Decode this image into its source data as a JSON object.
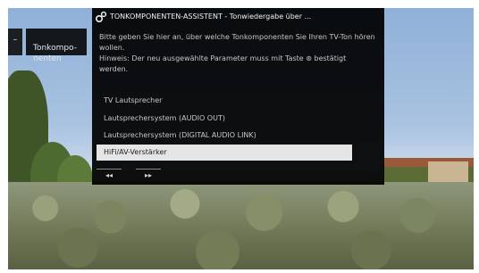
{
  "side_tab": {
    "symbol": "–"
  },
  "side_box": {
    "label": "Tonkompo-\nnenten"
  },
  "dialog": {
    "title": "TONKOMPONENTEN-ASSISTENT - Tonwiedergabe über ...",
    "description_line1": "Bitte geben Sie hier an, über welche Tonkomponenten Sie Ihren TV-Ton hören wollen.",
    "description_line2": "Hinweis: Der neu ausgewählte Parameter muss mit Taste ⊛ bestätigt werden.",
    "options": [
      {
        "label": "TV Lautsprecher",
        "selected": false
      },
      {
        "label": "Lautsprechersystem (AUDIO OUT)",
        "selected": false
      },
      {
        "label": "Lautsprechersystem (DIGITAL AUDIO LINK)",
        "selected": false
      },
      {
        "label": "HiFi/AV-Verstärker",
        "selected": true
      }
    ],
    "nav_prev": "◂◂",
    "nav_next": "▸▸"
  },
  "colors": {
    "panel": "#000000",
    "selected_bg": "#e5e5e5",
    "sky": "#a9c3e0"
  }
}
